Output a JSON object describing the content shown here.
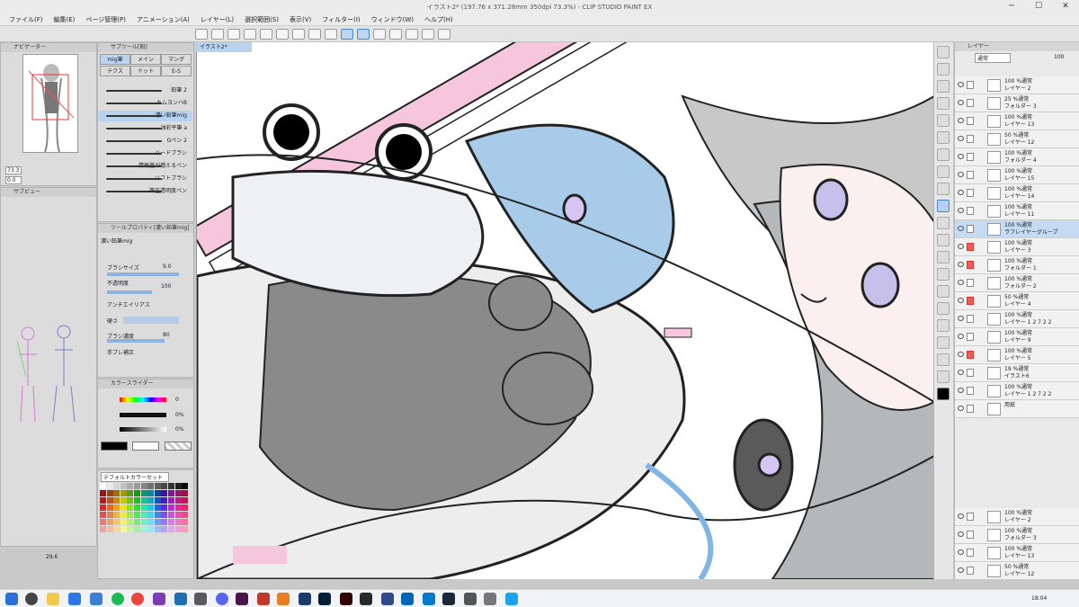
{
  "window": {
    "title": "イラスト2* (197.76 x 371.28mm 350dpi 73.3%) - CLIP STUDIO PAINT EX"
  },
  "menu": [
    "ファイル(F)",
    "編集(E)",
    "ページ管理(P)",
    "アニメーション(A)",
    "レイヤー(L)",
    "選択範囲(S)",
    "表示(V)",
    "フィルター(I)",
    "ウィンドウ(W)",
    "ヘルプ(H)"
  ],
  "navigator": {
    "title": "ナビゲーター",
    "zoom": "73.3",
    "angle": "0.0"
  },
  "subview": {
    "title": "サブビュー"
  },
  "subtool": {
    "title": "サブツール[鉛]",
    "tabs": [
      "mig筆",
      "メイン",
      "マング",
      "テクス",
      "ドット",
      "E-S"
    ],
    "brushes": [
      "鉛筆 2",
      "キムヨンハB",
      "濃い鉛筆mig",
      "油彩平筆 a",
      "Gペン 2",
      "ハードブラシ",
      "情報量が増えるペン",
      "ソフトブラシ",
      "筆圧透明度ペン"
    ],
    "selected_index": 2
  },
  "tool_property": {
    "title": "ツールプロパティ[濃い鉛筆mig]",
    "name": "濃い鉛筆mig",
    "brush_size_label": "ブラシサイズ",
    "brush_size": "9.0",
    "opacity_label": "不透明度",
    "opacity": "100",
    "antialias_label": "アンチエイリアス",
    "hardness_label": "硬さ",
    "density_label": "ブラシ濃度",
    "density": "80",
    "stabilization_label": "手ブレ補正"
  },
  "color_slider": {
    "title": "カラースライダー",
    "h": "0",
    "s": "0%",
    "v": "0%"
  },
  "color_set": {
    "title": "デフォルトカラーセット"
  },
  "bottom_zoom": "29.6",
  "doc_tab": "イラスト2*",
  "layer_panel": {
    "title": "レイヤー",
    "blend": "通常",
    "opacity": "100",
    "layers": [
      {
        "l1": "100 %通常",
        "l2": "レイヤー 2",
        "sel": false,
        "red": false
      },
      {
        "l1": "25 %通常",
        "l2": "フォルダー 3",
        "sel": false,
        "red": false
      },
      {
        "l1": "100 %通常",
        "l2": "レイヤー 13",
        "sel": false,
        "red": false
      },
      {
        "l1": "50 %通常",
        "l2": "レイヤー 12",
        "sel": false,
        "red": false
      },
      {
        "l1": "100 %通常",
        "l2": "フォルダー 4",
        "sel": false,
        "red": false
      },
      {
        "l1": "100 %通常",
        "l2": "レイヤー 15",
        "sel": false,
        "red": false
      },
      {
        "l1": "100 %通常",
        "l2": "レイヤー 14",
        "sel": false,
        "red": false
      },
      {
        "l1": "100 %通常",
        "l2": "レイヤー 11",
        "sel": false,
        "red": false
      },
      {
        "l1": "100 %通常",
        "l2": "ラフレイヤーグループ",
        "sel": true,
        "red": false
      },
      {
        "l1": "100 %通常",
        "l2": "レイヤー 3",
        "sel": false,
        "red": true
      },
      {
        "l1": "100 %通常",
        "l2": "フォルダー 1",
        "sel": false,
        "red": true
      },
      {
        "l1": "100 %通常",
        "l2": "フォルダー 2",
        "sel": false,
        "red": false
      },
      {
        "l1": "50 %通常",
        "l2": "レイヤー 4",
        "sel": false,
        "red": true
      },
      {
        "l1": "100 %通常",
        "l2": "レイヤー 1 2 7 2 2",
        "sel": false,
        "red": false
      },
      {
        "l1": "100 %通常",
        "l2": "レイヤー 9",
        "sel": false,
        "red": false
      },
      {
        "l1": "100 %通常",
        "l2": "レイヤー 5",
        "sel": false,
        "red": true
      },
      {
        "l1": "19 %通常",
        "l2": "イラスト6",
        "sel": false,
        "red": false
      },
      {
        "l1": "100 %通常",
        "l2": "レイヤー 1 2 7 2 2",
        "sel": false,
        "red": false
      },
      {
        "l1": "",
        "l2": "用紙",
        "sel": false,
        "red": false
      }
    ],
    "lower_layers": [
      {
        "l1": "100 %通常",
        "l2": "レイヤー 2"
      },
      {
        "l1": "100 %通常",
        "l2": "フォルダー 3"
      },
      {
        "l1": "100 %通常",
        "l2": "レイヤー 13"
      },
      {
        "l1": "50 %通常",
        "l2": "レイヤー 12"
      }
    ]
  },
  "taskbar": {
    "time": "18:04"
  }
}
